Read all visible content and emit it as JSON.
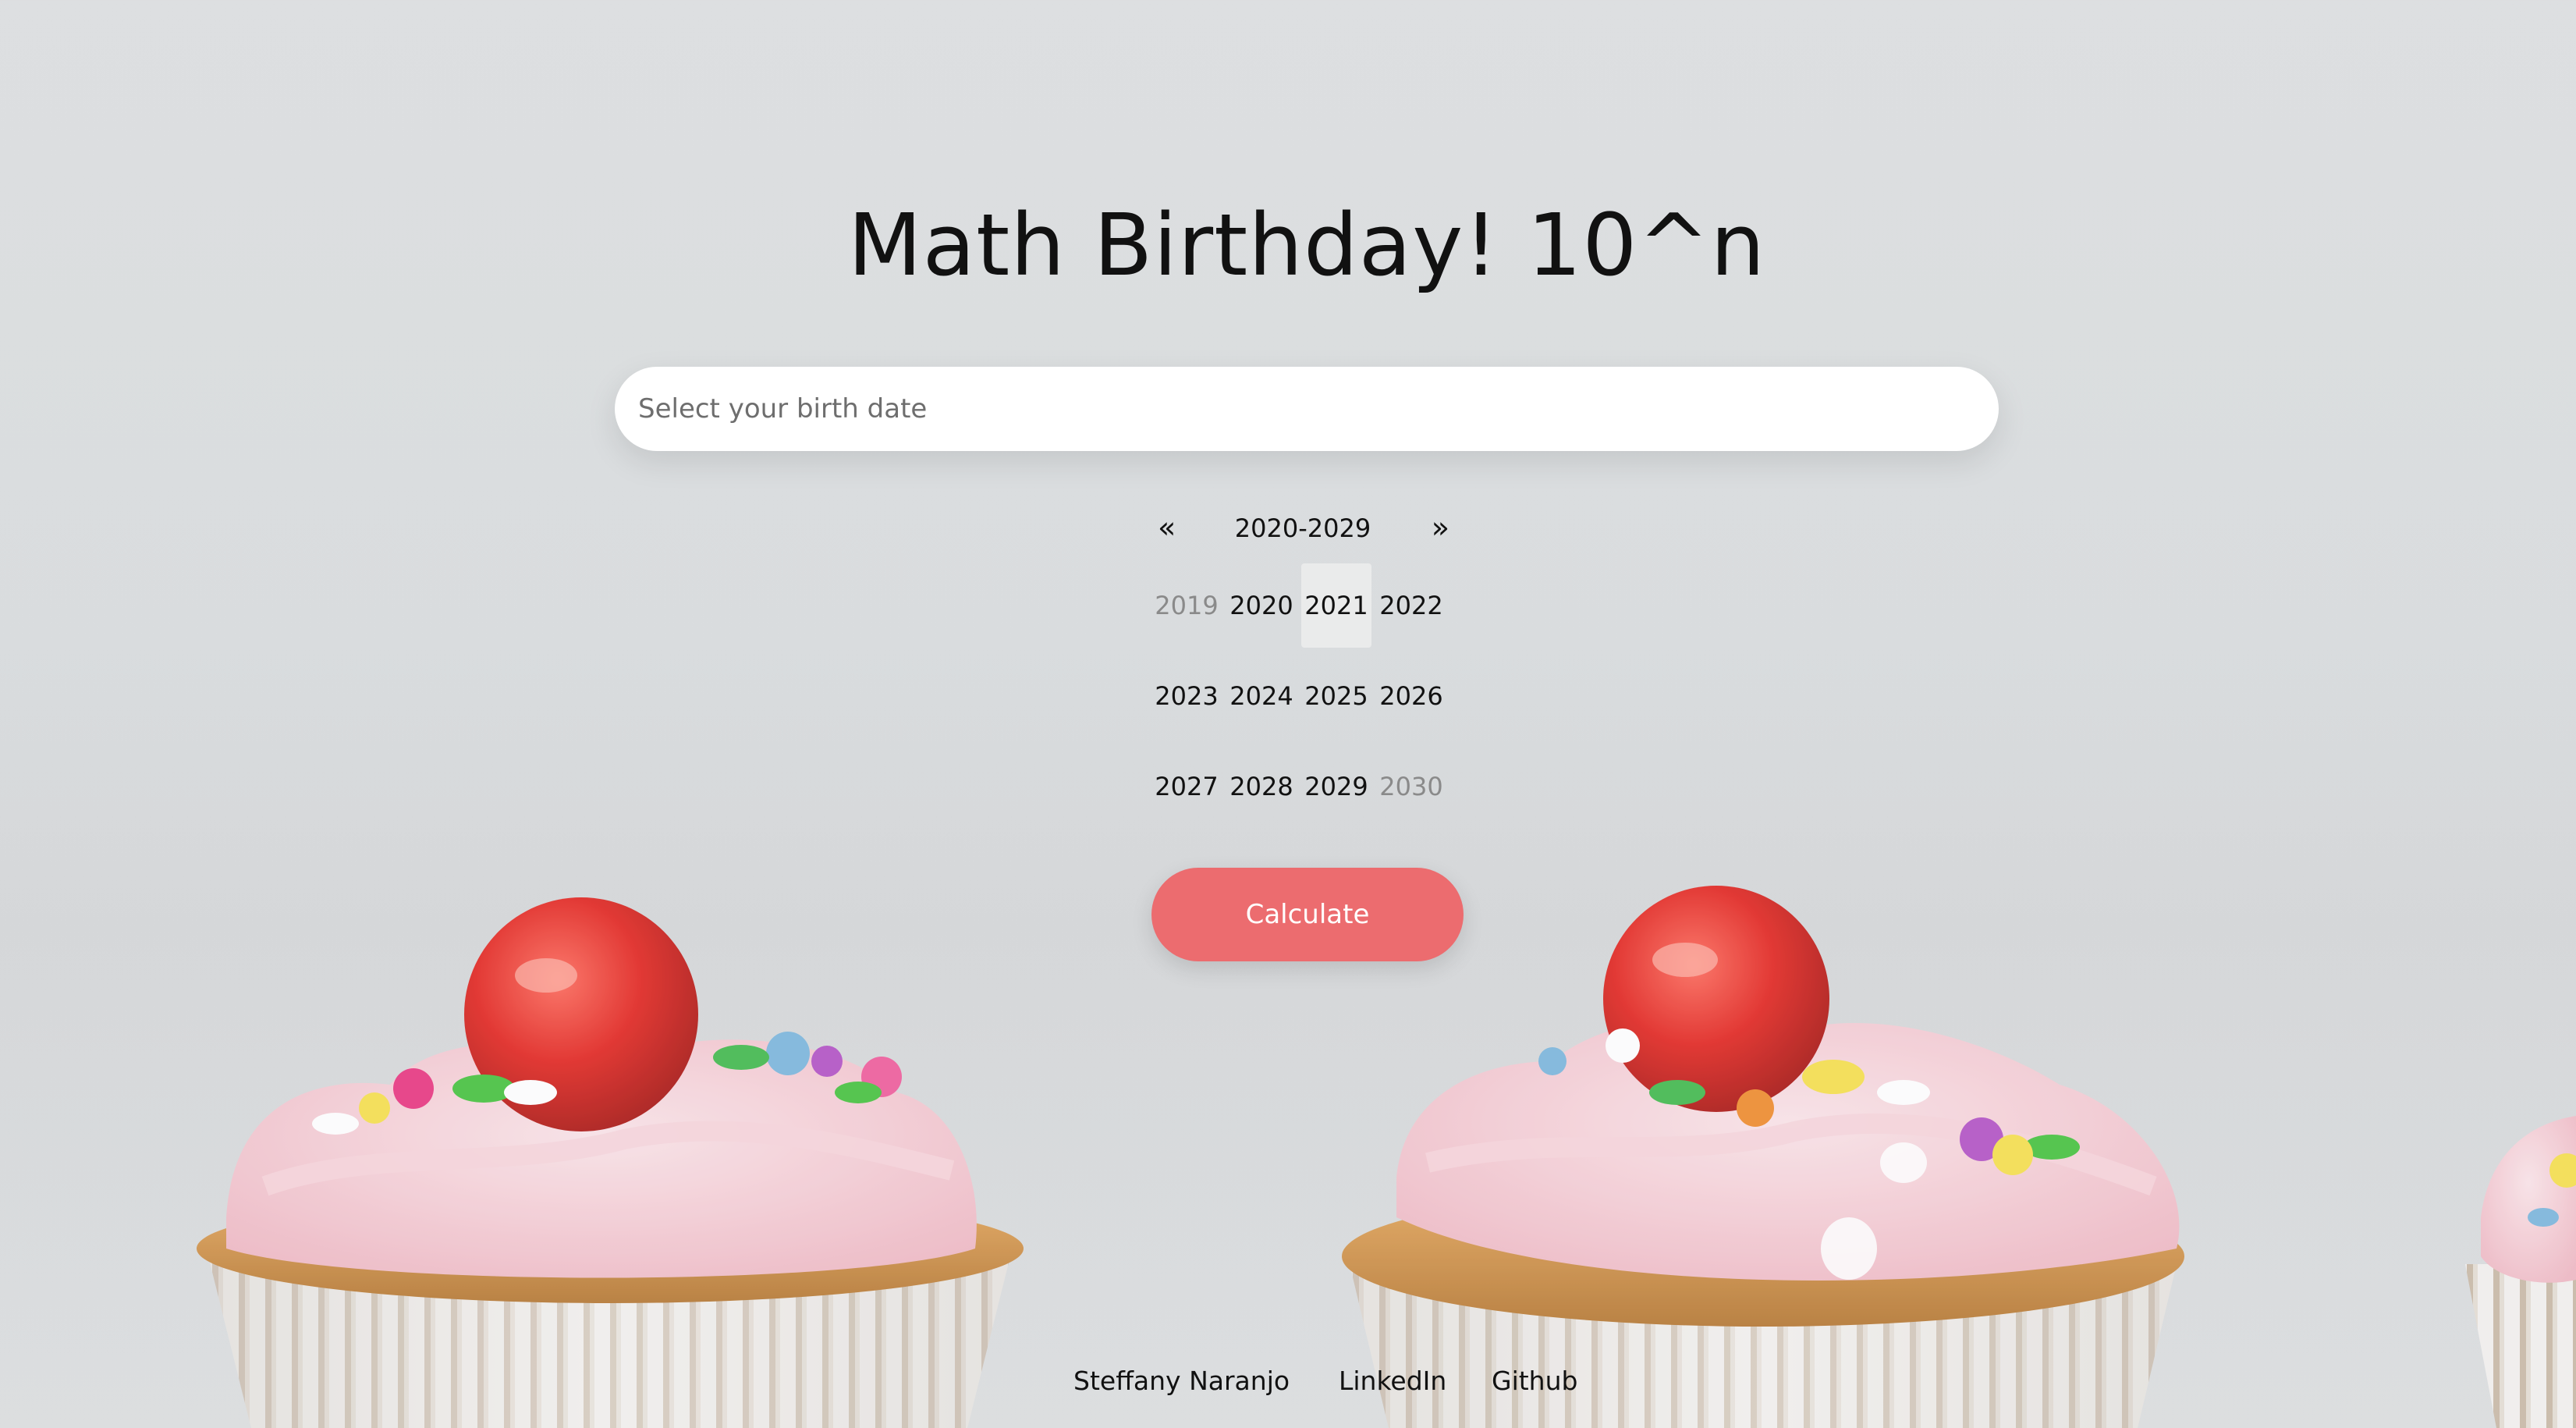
{
  "header": {
    "title": "Math Birthday! 10^n"
  },
  "birth_date_input": {
    "placeholder": "Select your birth date",
    "value": ""
  },
  "year_picker": {
    "prev_label": "«",
    "next_label": "»",
    "range_label": "2020-2029",
    "selected": "2021",
    "years": [
      {
        "label": "2019",
        "outside_range": true
      },
      {
        "label": "2020",
        "outside_range": false
      },
      {
        "label": "2021",
        "outside_range": false
      },
      {
        "label": "2022",
        "outside_range": false
      },
      {
        "label": "2023",
        "outside_range": false
      },
      {
        "label": "2024",
        "outside_range": false
      },
      {
        "label": "2025",
        "outside_range": false
      },
      {
        "label": "2026",
        "outside_range": false
      },
      {
        "label": "2027",
        "outside_range": false
      },
      {
        "label": "2028",
        "outside_range": false
      },
      {
        "label": "2029",
        "outside_range": false
      },
      {
        "label": "2030",
        "outside_range": true
      }
    ]
  },
  "calculate_button": {
    "label": "Calculate",
    "color": "#ec6c6f"
  },
  "footer": {
    "author": "Steffany Naranjo",
    "linkedin": "LinkedIn",
    "github": "Github"
  },
  "background": {
    "subject": "cupcakes-with-pink-frosting-and-cherries"
  }
}
